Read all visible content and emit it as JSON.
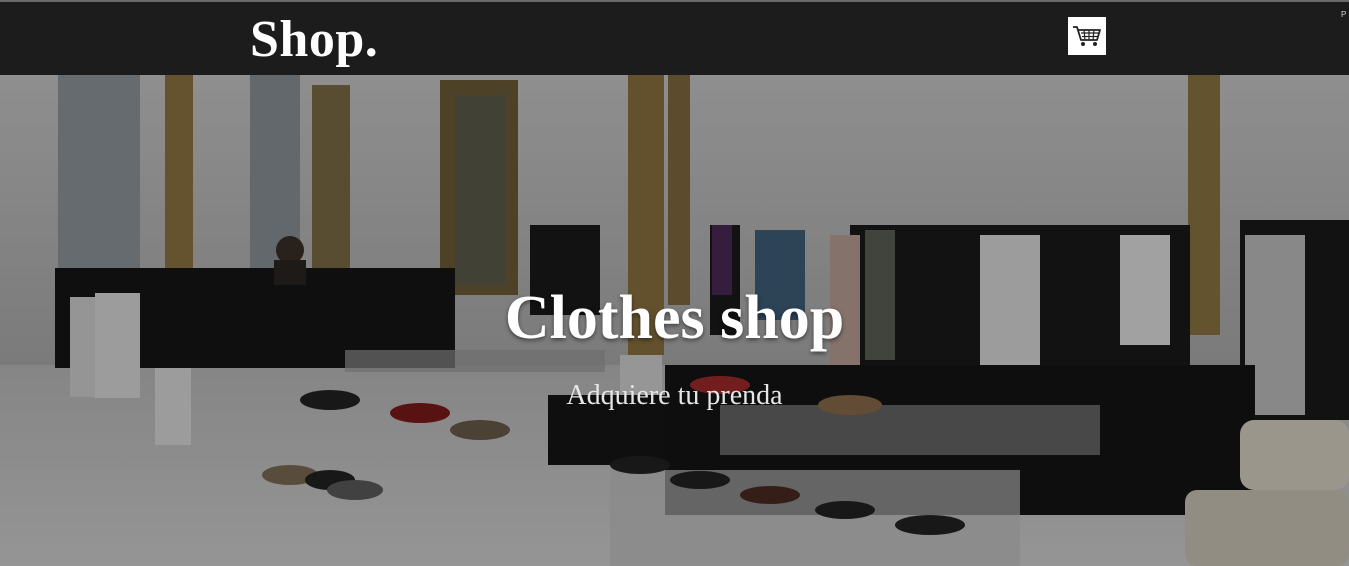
{
  "header": {
    "brand": "Shop.",
    "cart_icon": "shopping-cart-icon",
    "edge_text": "P"
  },
  "hero": {
    "title": "Clothes shop",
    "subtitle": "Adquiere tu prenda",
    "image": "clothing-store-interior-photo"
  },
  "colors": {
    "navbar_bg": "#1c1c1c",
    "brand_text": "#ffffff",
    "cart_button_bg": "#ffffff",
    "hero_title": "#ffffff",
    "hero_subtitle": "#e6e6e6"
  }
}
